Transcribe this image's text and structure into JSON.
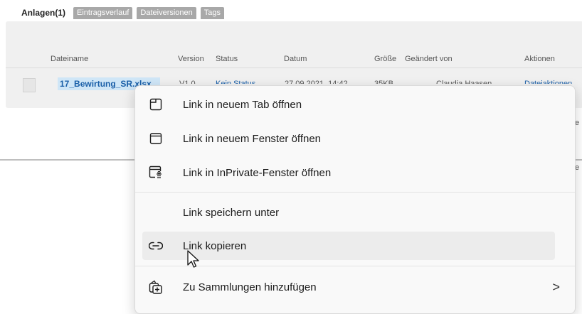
{
  "tabs": [
    {
      "label": "Anlagen(1)",
      "active": true
    },
    {
      "label": "Eintragsverlauf",
      "active": false
    },
    {
      "label": "Dateiversionen",
      "active": false
    },
    {
      "label": "Tags",
      "active": false
    }
  ],
  "table": {
    "columns": [
      "Dateiname",
      "Version",
      "Status",
      "Datum",
      "Größe",
      "Geändert von",
      "Aktionen"
    ],
    "row": {
      "file_name": "17_Bewirtung_SR.xlsx",
      "version": "V1.0",
      "status": "Kein Status",
      "date": "27.09.2021, 14:42",
      "size": "35KB",
      "changed_by": "Claudia Haasen",
      "action": "Dateiaktionen"
    }
  },
  "edge_letters": [
    "e",
    "e"
  ],
  "context_menu": {
    "items": [
      {
        "label": "Link in neuem Tab öffnen",
        "icon": "new-tab-icon"
      },
      {
        "label": "Link in neuem Fenster öffnen",
        "icon": "new-window-icon"
      },
      {
        "label": "Link in InPrivate-Fenster öffnen",
        "icon": "inprivate-window-icon"
      },
      {
        "label": "Link speichern unter",
        "icon": ""
      },
      {
        "label": "Link kopieren",
        "icon": "link-icon",
        "hover": true
      },
      {
        "label": "Zu Sammlungen hinzufügen",
        "icon": "collections-icon",
        "submenu": true
      }
    ],
    "submenu_glyph": ">"
  },
  "colors": {
    "accent_link": "#1a5fa8",
    "selection": "#cfe6f7",
    "tab_inactive": "#a8a8a8"
  }
}
